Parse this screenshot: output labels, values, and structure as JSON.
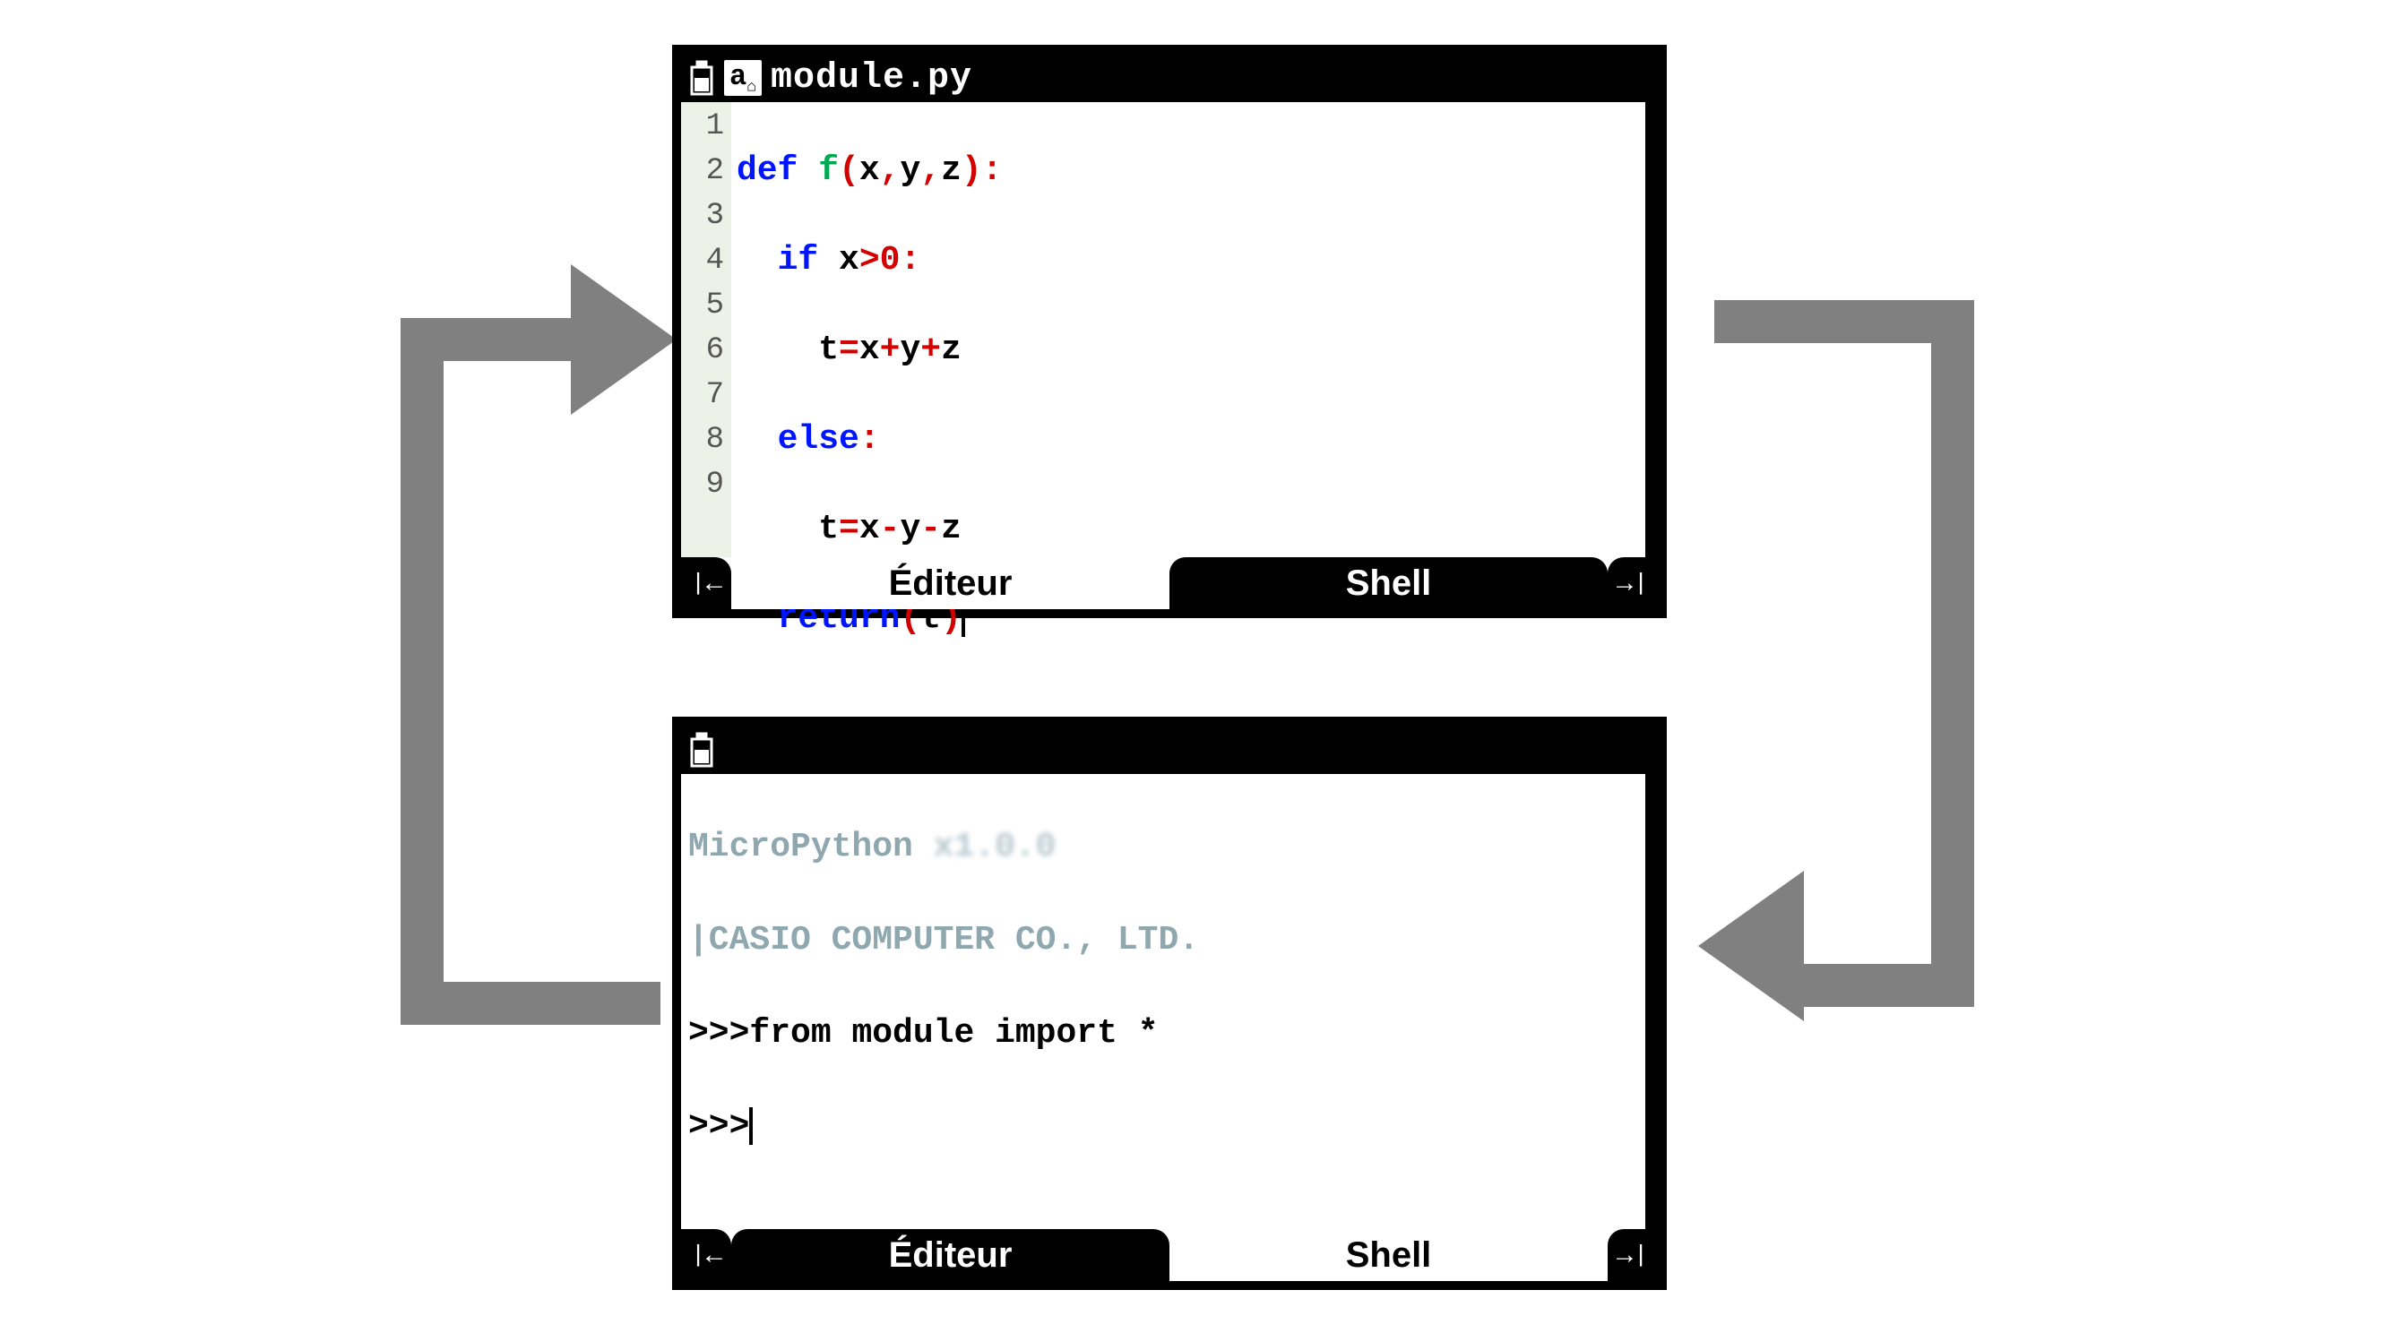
{
  "editor_screen": {
    "title": "module.py",
    "alpha_badge": "a",
    "line_numbers": [
      "1",
      "2",
      "3",
      "4",
      "5",
      "6",
      "7",
      "8",
      "9"
    ],
    "code": {
      "l1": {
        "kw": "def",
        "fn": "f",
        "op1": "(",
        "args": "x",
        "c1": ",",
        "a2": "y",
        "c2": ",",
        "a3": "z",
        "op2": "):"
      },
      "l2": {
        "indent": "  ",
        "kw": "if",
        "sp": " ",
        "v": "x",
        "op": ">",
        "n": "0",
        "colon": ":"
      },
      "l3": {
        "indent": "    ",
        "t": "t",
        "eq": "=",
        "x": "x",
        "p1": "+",
        "y": "y",
        "p2": "+",
        "z": "z"
      },
      "l4": {
        "indent": "  ",
        "kw": "else",
        "colon": ":"
      },
      "l5": {
        "indent": "    ",
        "t": "t",
        "eq": "=",
        "x": "x",
        "m1": "-",
        "y": "y",
        "m2": "-",
        "z": "z"
      },
      "l6": {
        "indent": "  ",
        "kw": "return",
        "open": "(",
        "v": "t",
        "close": ")"
      }
    },
    "tabs": {
      "left": "Éditeur",
      "right": "Shell",
      "active": "right"
    }
  },
  "shell_screen": {
    "header1_a": "MicroPython ",
    "header1_b": "x1.0.0",
    "header2": "|CASIO COMPUTER CO., LTD.",
    "prompt": ">>>",
    "line1": "from module import *",
    "tabs": {
      "left": "Éditeur",
      "right": "Shell",
      "active": "left"
    }
  },
  "arrows": {
    "nav_prev": "❮←",
    "nav_next": "→❯"
  }
}
